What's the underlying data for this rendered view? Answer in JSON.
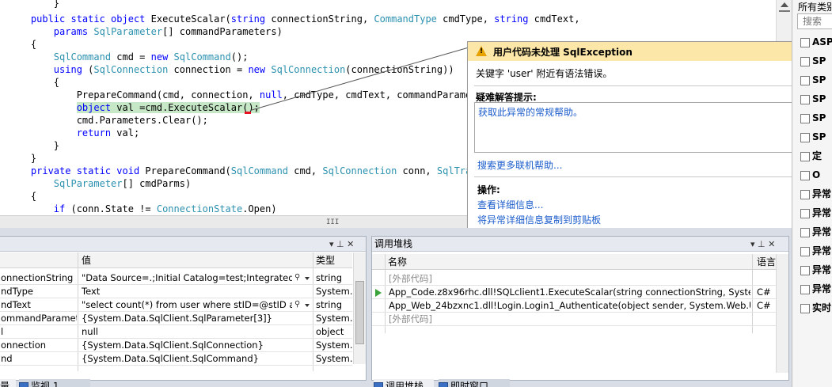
{
  "editor": {
    "lines": [
      {
        "segs": [
          {
            "t": "        }",
            "c": ""
          }
        ]
      },
      {
        "segs": [
          {
            "t": "    ",
            "c": ""
          },
          {
            "t": "public static object",
            "c": "kw"
          },
          {
            "t": " ExecuteScalar(",
            "c": ""
          },
          {
            "t": "string",
            "c": "kw"
          },
          {
            "t": " connectionString, ",
            "c": ""
          },
          {
            "t": "CommandType",
            "c": "ty"
          },
          {
            "t": " cmdType, ",
            "c": ""
          },
          {
            "t": "string",
            "c": "kw"
          },
          {
            "t": " cmdText,",
            "c": ""
          }
        ]
      },
      {
        "segs": [
          {
            "t": "        ",
            "c": ""
          },
          {
            "t": "params",
            "c": "kw"
          },
          {
            "t": " ",
            "c": ""
          },
          {
            "t": "SqlParameter",
            "c": "ty"
          },
          {
            "t": "[] commandParameters)",
            "c": ""
          }
        ]
      },
      {
        "segs": [
          {
            "t": "    {",
            "c": ""
          }
        ]
      },
      {
        "segs": [
          {
            "t": "        ",
            "c": ""
          },
          {
            "t": "SqlCommand",
            "c": "ty"
          },
          {
            "t": " cmd = ",
            "c": ""
          },
          {
            "t": "new",
            "c": "kw"
          },
          {
            "t": " ",
            "c": ""
          },
          {
            "t": "SqlCommand",
            "c": "ty"
          },
          {
            "t": "();",
            "c": ""
          }
        ]
      },
      {
        "segs": [
          {
            "t": "        ",
            "c": ""
          },
          {
            "t": "using",
            "c": "kw"
          },
          {
            "t": " (",
            "c": ""
          },
          {
            "t": "SqlConnection",
            "c": "ty"
          },
          {
            "t": " connection = ",
            "c": ""
          },
          {
            "t": "new",
            "c": "kw"
          },
          {
            "t": " ",
            "c": ""
          },
          {
            "t": "SqlConnection",
            "c": "ty"
          },
          {
            "t": "(connectionString))",
            "c": ""
          }
        ]
      },
      {
        "segs": [
          {
            "t": "        {",
            "c": ""
          }
        ]
      },
      {
        "segs": [
          {
            "t": "            PrepareCommand(cmd, connection, ",
            "c": ""
          },
          {
            "t": "null",
            "c": "kw"
          },
          {
            "t": ", cmdType, cmdText, commandParameters);",
            "c": ""
          }
        ]
      },
      {
        "segs": [
          {
            "t": "            ",
            "c": ""
          },
          {
            "t": "object",
            "c": "kw hl"
          },
          {
            "t": " val =cmd.ExecuteScalar();",
            "c": "hl"
          }
        ]
      },
      {
        "segs": [
          {
            "t": "            cmd.Parameters.Clear();",
            "c": ""
          }
        ]
      },
      {
        "segs": [
          {
            "t": "            ",
            "c": ""
          },
          {
            "t": "return",
            "c": "kw"
          },
          {
            "t": " val;",
            "c": ""
          }
        ]
      },
      {
        "segs": [
          {
            "t": "        }",
            "c": ""
          }
        ]
      },
      {
        "segs": [
          {
            "t": "    }",
            "c": ""
          }
        ]
      },
      {
        "segs": [
          {
            "t": "    ",
            "c": ""
          },
          {
            "t": "private static void",
            "c": "kw"
          },
          {
            "t": " PrepareCommand(",
            "c": ""
          },
          {
            "t": "SqlCommand",
            "c": "ty"
          },
          {
            "t": " cmd, ",
            "c": ""
          },
          {
            "t": "SqlConnection",
            "c": "ty"
          },
          {
            "t": " conn, ",
            "c": ""
          },
          {
            "t": "SqlTransaction",
            "c": "ty"
          },
          {
            "t": " trans,",
            "c": ""
          }
        ]
      },
      {
        "segs": [
          {
            "t": "        ",
            "c": ""
          },
          {
            "t": "SqlParameter",
            "c": "ty"
          },
          {
            "t": "[] cmdParms)",
            "c": ""
          }
        ]
      },
      {
        "segs": [
          {
            "t": "    {",
            "c": ""
          }
        ]
      },
      {
        "segs": [
          {
            "t": "        ",
            "c": ""
          },
          {
            "t": "if",
            "c": "kw"
          },
          {
            "t": " (conn.State != ",
            "c": ""
          },
          {
            "t": "ConnectionState",
            "c": "ty"
          },
          {
            "t": ".Open)",
            "c": ""
          }
        ]
      }
    ],
    "hscroll_glyph": "III"
  },
  "exception": {
    "title": "用户代码未处理 SqlException",
    "message": "关键字 'user' 附近有语法错误。",
    "hint_title": "疑难解答提示:",
    "hint_link": "获取此异常的常规帮助。",
    "more_help": "搜索更多联机帮助...",
    "actions_title": "操作:",
    "action_details": "查看详细信息...",
    "action_copy": "将异常详细信息复制到剪贴板",
    "close_glyph": "×"
  },
  "right_panel": {
    "title": "所有类别",
    "search_placeholder": "搜索",
    "items": [
      "ASP",
      "SP",
      "SP",
      "SP",
      "SP",
      "SP",
      "定",
      "O",
      "异常",
      "异常",
      "异常",
      "异常",
      "异常",
      "异常",
      "实时"
    ]
  },
  "locals": {
    "controls": "▾ ⊥ ✕",
    "columns": [
      "值",
      "类型"
    ],
    "rows": [
      {
        "name": "onnectionString",
        "value": "\"Data Source=.;Initial Catalog=test;Integrated Secu",
        "type": "string",
        "search": true
      },
      {
        "name": "ndType",
        "value": "Text",
        "type": "System.D",
        "search": false
      },
      {
        "name": "ndText",
        "value": "\"select count(*) from user where stID=@stID and s",
        "type": "string",
        "search": true
      },
      {
        "name": "ommandParameter",
        "value": "{System.Data.SqlClient.SqlParameter[3]}",
        "type": "System.D",
        "search": false
      },
      {
        "name": "l",
        "value": "null",
        "type": "object",
        "search": false
      },
      {
        "name": "onnection",
        "value": "{System.Data.SqlClient.SqlConnection}",
        "type": "System.D",
        "search": false
      },
      {
        "name": "nd",
        "value": "{System.Data.SqlClient.SqlCommand}",
        "type": "System.D",
        "search": false
      }
    ],
    "tab_left": "量",
    "tab_watch": "监视 1"
  },
  "callstack": {
    "title": "调用堆栈",
    "controls": "▾ ⊥ ✕",
    "columns": [
      "名称",
      "语言"
    ],
    "rows": [
      {
        "name": "[外部代码]",
        "lang": "",
        "grey": true,
        "current": false
      },
      {
        "name": "App_Code.z8x96rhc.dll!SQLclient1.ExecuteScalar(string connectionString, System.Data.C",
        "lang": "C#",
        "grey": false,
        "current": true
      },
      {
        "name": "App_Web_24bzxnc1.dll!Login.Login1_Authenticate(object sender, System.Web.UI.WebC",
        "lang": "C#",
        "grey": false,
        "current": false
      },
      {
        "name": "[外部代码]",
        "lang": "",
        "grey": true,
        "current": false
      }
    ],
    "tab_callstack": "调用堆栈",
    "tab_immediate": "即时窗口"
  }
}
